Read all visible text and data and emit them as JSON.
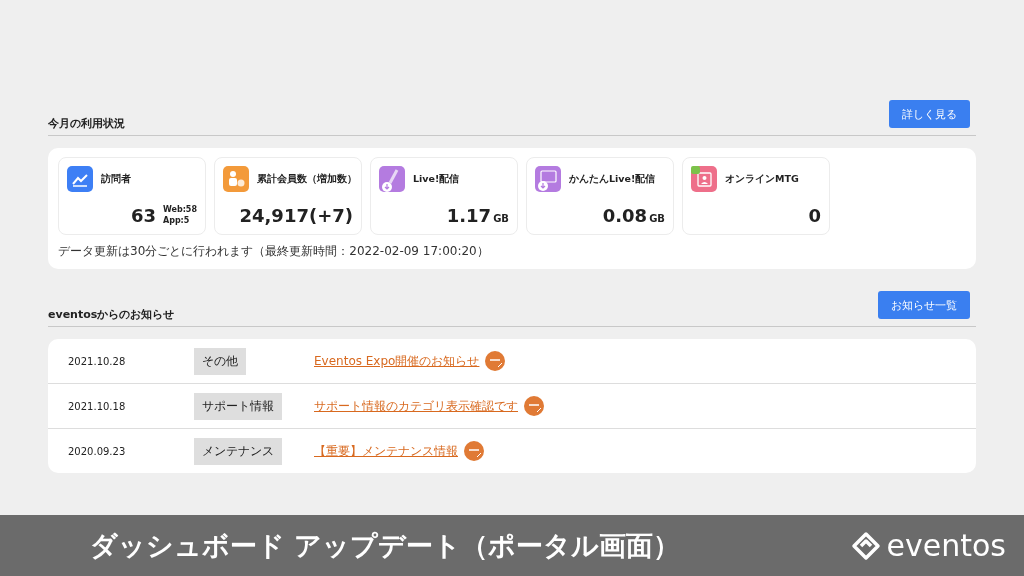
{
  "usage": {
    "title": "今月の利用状況",
    "more_button": "詳しく見る",
    "stats": [
      {
        "kind": "visitors",
        "label": "訪問者",
        "value": "63",
        "sub": [
          "Web:58",
          "App:5"
        ]
      },
      {
        "kind": "members",
        "label": "累計会員数（増加数）",
        "value": "24,917(+7)"
      },
      {
        "kind": "live",
        "label": "Live!配信",
        "value": "1.17",
        "unit": "GB"
      },
      {
        "kind": "easy-live",
        "label": "かんたんLive!配信",
        "value": "0.08",
        "unit": "GB"
      },
      {
        "kind": "meeting",
        "label": "オンラインMTG",
        "value": "0"
      }
    ],
    "note": "データ更新は30分ごとに行われます（最終更新時間：2022-02-09 17:00:20）"
  },
  "news": {
    "title": "eventosからのお知らせ",
    "list_button": "お知らせ一覧",
    "items": [
      {
        "date": "2021.10.28",
        "category": "その他",
        "title": "Eventos Expo開催のお知らせ",
        "new": true
      },
      {
        "date": "2021.10.18",
        "category": "サポート情報",
        "title": "サポート情報のカテゴリ表示確認です",
        "new": true
      },
      {
        "date": "2020.09.23",
        "category": "メンテナンス",
        "title": "【重要】メンテナンス情報",
        "new": true
      }
    ]
  },
  "banner": {
    "title": "ダッシュボード アップデート（ポータル画面）",
    "logo": "eventos"
  }
}
